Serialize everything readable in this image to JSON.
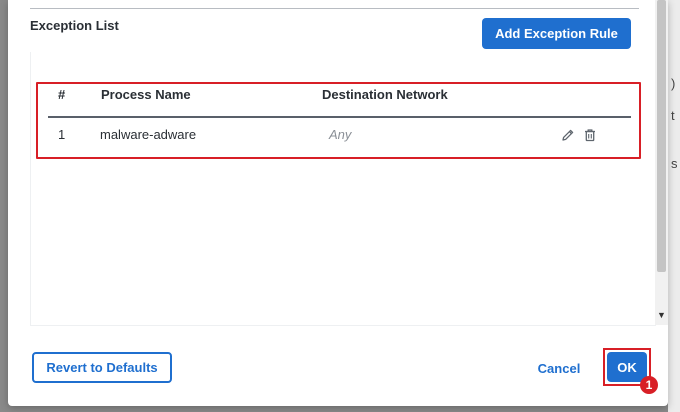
{
  "dialog": {
    "section_title": "Exception List",
    "add_rule_label": "Add Exception Rule"
  },
  "table": {
    "columns": [
      "#",
      "Process Name",
      "Destination Network"
    ],
    "rows": [
      {
        "index": "1",
        "process_name": "malware-adware",
        "destination": "Any"
      }
    ]
  },
  "footer": {
    "revert_label": "Revert to Defaults",
    "cancel_label": "Cancel",
    "ok_label": "OK"
  },
  "annotation": {
    "step_number": "1"
  },
  "background_page": {
    "fragments": [
      ")",
      "t",
      "s"
    ]
  },
  "colors": {
    "primary": "#1f6fcf",
    "highlight": "#d81f26"
  }
}
